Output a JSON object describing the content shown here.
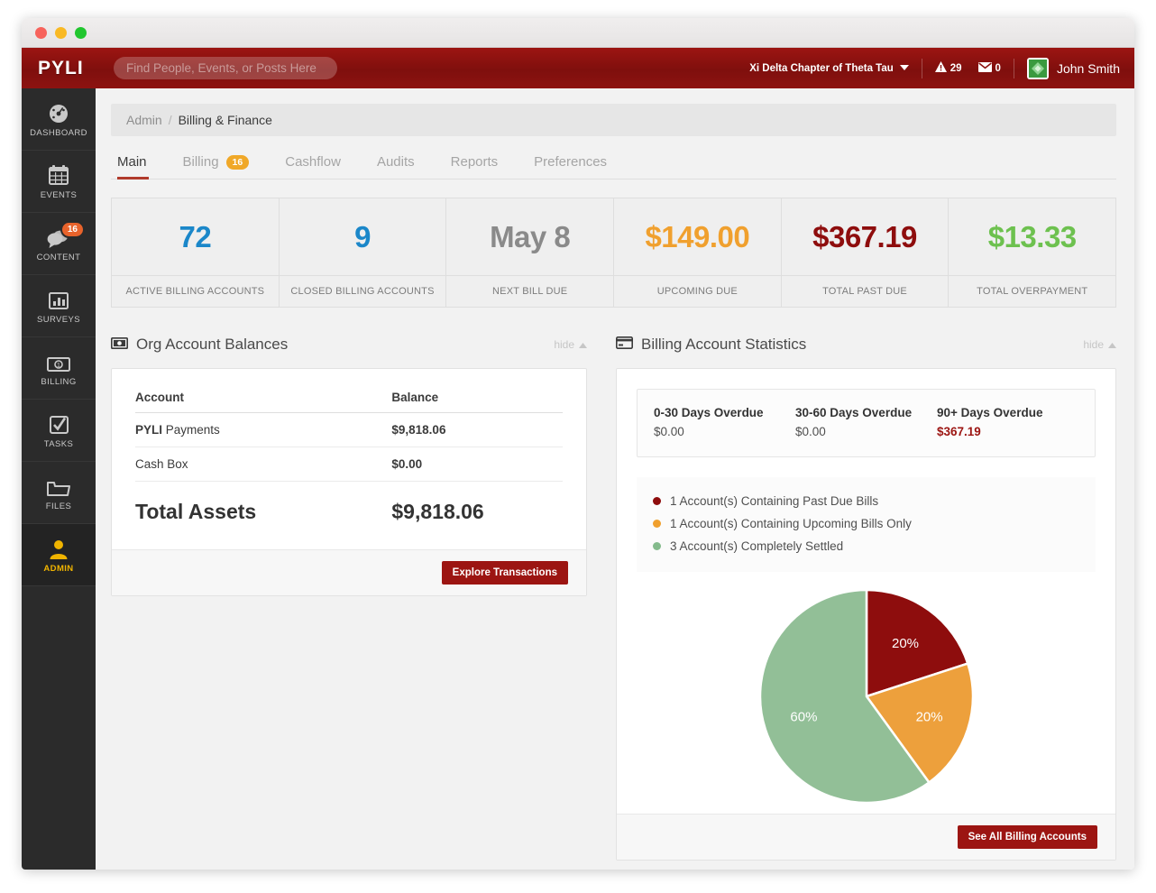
{
  "topbar": {
    "logo": "PYLI",
    "search_placeholder": "Find People, Events, or Posts Here",
    "search_value": "",
    "org_name": "Xi Delta Chapter of Theta Tau",
    "alerts_count": "29",
    "messages_count": "0",
    "user_name": "John Smith"
  },
  "sidebar": {
    "items": [
      {
        "label": "DASHBOARD",
        "icon": "gauge-icon",
        "badge": "",
        "active": false
      },
      {
        "label": "EVENTS",
        "icon": "calendar-icon",
        "badge": "",
        "active": false
      },
      {
        "label": "CONTENT",
        "icon": "chat-bubble-icon",
        "badge": "16",
        "active": false
      },
      {
        "label": "SURVEYS",
        "icon": "bar-chart-icon",
        "badge": "",
        "active": false
      },
      {
        "label": "BILLING",
        "icon": "banknote-icon",
        "badge": "",
        "active": false
      },
      {
        "label": "TASKS",
        "icon": "checkbox-icon",
        "badge": "",
        "active": false
      },
      {
        "label": "FILES",
        "icon": "folder-icon",
        "badge": "",
        "active": false
      },
      {
        "label": "ADMIN",
        "icon": "user-icon",
        "badge": "",
        "active": true
      }
    ]
  },
  "breadcrumb": {
    "parent": "Admin",
    "separator": "/",
    "current": "Billing & Finance"
  },
  "tabs": [
    {
      "label": "Main",
      "badge": "",
      "active": true
    },
    {
      "label": "Billing",
      "badge": "16",
      "active": false
    },
    {
      "label": "Cashflow",
      "badge": "",
      "active": false
    },
    {
      "label": "Audits",
      "badge": "",
      "active": false
    },
    {
      "label": "Reports",
      "badge": "",
      "active": false
    },
    {
      "label": "Preferences",
      "badge": "",
      "active": false
    }
  ],
  "stats": [
    {
      "value": "72",
      "label": "ACTIVE BILLING ACCOUNTS",
      "color": "#1b87c9"
    },
    {
      "value": "9",
      "label": "CLOSED BILLING ACCOUNTS",
      "color": "#1b87c9"
    },
    {
      "value": "May 8",
      "label": "NEXT BILL DUE",
      "color": "#8a8a8a"
    },
    {
      "value": "$149.00",
      "label": "UPCOMING DUE",
      "color": "#f0a02e"
    },
    {
      "value": "$367.19",
      "label": "TOTAL PAST DUE",
      "color": "#8e0d0d"
    },
    {
      "value": "$13.33",
      "label": "TOTAL OVERPAYMENT",
      "color": "#6dc14f"
    }
  ],
  "org_balances": {
    "title": "Org Account Balances",
    "icon": "banknote-icon",
    "hide_label": "hide",
    "columns": [
      "Account",
      "Balance"
    ],
    "rows": [
      {
        "account_bold": "PYLI",
        "account_rest": " Payments",
        "balance": "$9,818.06"
      },
      {
        "account_bold": "",
        "account_rest": "Cash Box",
        "balance": "$0.00"
      }
    ],
    "total_label": "Total Assets",
    "total_value": "$9,818.06",
    "button_label": "Explore Transactions"
  },
  "billing_stats": {
    "title": "Billing Account Statistics",
    "icon": "credit-card-icon",
    "hide_label": "hide",
    "overdue": [
      {
        "title": "0-30 Days Overdue",
        "value": "$0.00",
        "danger": false
      },
      {
        "title": "30-60 Days Overdue",
        "value": "$0.00",
        "danger": false
      },
      {
        "title": "90+ Days Overdue",
        "value": "$367.19",
        "danger": true
      }
    ],
    "legend": [
      {
        "text": "1 Account(s) Containing Past Due Bills",
        "color": "#8e0d0d"
      },
      {
        "text": "1 Account(s) Containing Upcoming Bills Only",
        "color": "#f0a02e"
      },
      {
        "text": "3 Account(s) Completely Settled",
        "color": "#84bb8c"
      }
    ],
    "button_label": "See All Billing Accounts"
  },
  "chart_data": {
    "type": "pie",
    "title": "Billing Account Statistics",
    "categories": [
      "1 Account(s) Containing Past Due Bills",
      "1 Account(s) Containing Upcoming Bills Only",
      "3 Account(s) Completely Settled"
    ],
    "values": [
      20,
      20,
      60
    ],
    "labels": [
      "20%",
      "20%",
      "60%"
    ],
    "colors": [
      "#8e0d0d",
      "#eda03c",
      "#92bf97"
    ],
    "legend_position": "top",
    "start_angle_deg": 0
  }
}
